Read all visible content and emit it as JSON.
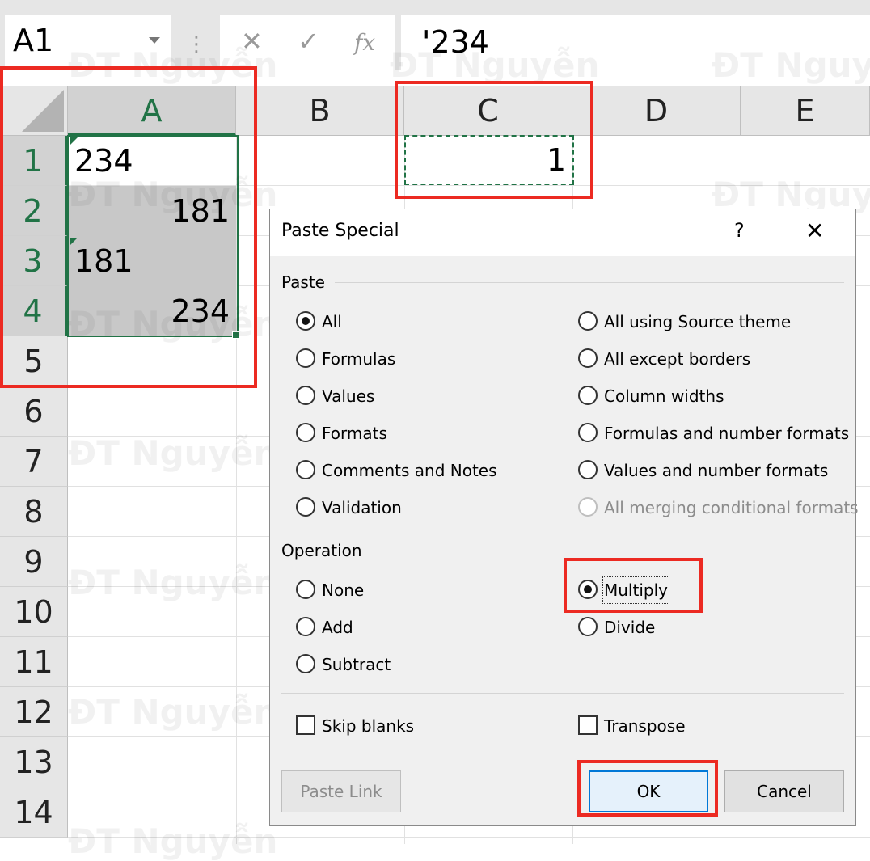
{
  "formula_bar": {
    "cell_ref": "A1",
    "separator_glyph": "⋮",
    "cancel_glyph": "✕",
    "enter_glyph": "✓",
    "fx_glyph": "fx",
    "formula": "'234"
  },
  "sheet": {
    "columns": [
      "A",
      "B",
      "C",
      "D",
      "E"
    ],
    "rows": [
      "1",
      "2",
      "3",
      "4",
      "5",
      "6",
      "7",
      "8",
      "9",
      "10",
      "11",
      "12",
      "13",
      "14"
    ],
    "cells": {
      "A1": "234",
      "A2": "181",
      "A3": "181",
      "A4": "234",
      "C1": "1"
    },
    "watermark": "ĐT Nguyễn"
  },
  "dialog": {
    "title": "Paste Special",
    "help": "?",
    "close": "✕",
    "paste_section": "Paste",
    "paste_options_left": [
      "All",
      "Formulas",
      "Values",
      "Formats",
      "Comments and Notes",
      "Validation"
    ],
    "paste_options_right": [
      "All using Source theme",
      "All except borders",
      "Column widths",
      "Formulas and number formats",
      "Values and number formats",
      "All merging conditional formats"
    ],
    "paste_selected": "All",
    "operation_section": "Operation",
    "operation_options_left": [
      "None",
      "Add",
      "Subtract"
    ],
    "operation_options_right": [
      "Multiply",
      "Divide"
    ],
    "operation_selected": "Multiply",
    "skip_blanks": "Skip blanks",
    "transpose": "Transpose",
    "paste_link": "Paste Link",
    "ok": "OK",
    "cancel": "Cancel"
  },
  "colors": {
    "excel_green": "#217346",
    "highlight_red": "#ec2a22"
  }
}
